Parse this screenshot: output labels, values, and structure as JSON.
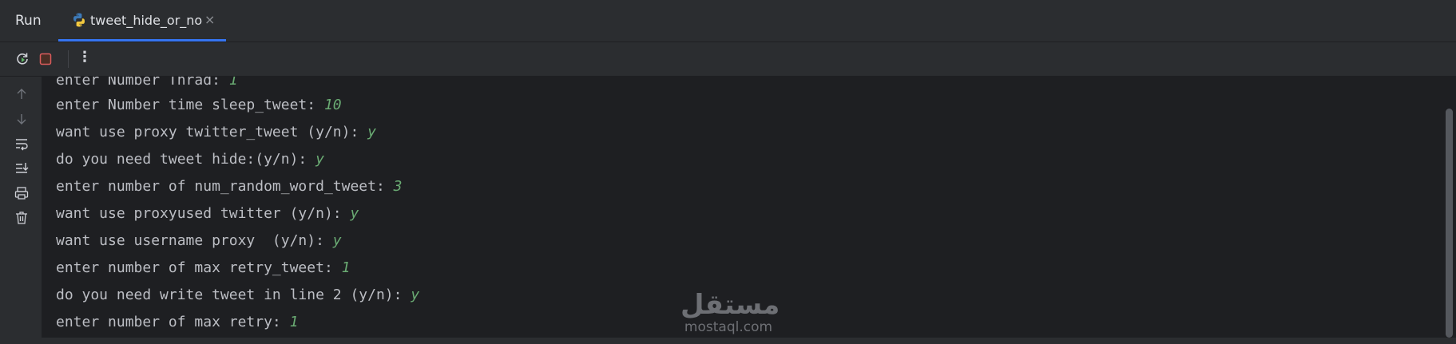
{
  "tabbar": {
    "run_label": "Run",
    "tab_label": "tweet_hide_or_no",
    "close_glyph": "×",
    "accent": "#3574f0"
  },
  "toolbar": {
    "icons": [
      "rerun-icon",
      "stop-icon",
      "more-vertical-icon"
    ],
    "more_glyph": "⋮"
  },
  "gutter": {
    "icons": [
      "arrow-up-icon",
      "arrow-down-icon",
      "soft-wrap-icon",
      "scroll-to-end-icon",
      "print-icon",
      "trash-icon"
    ]
  },
  "console": {
    "input_color": "#6aab73",
    "lines": [
      {
        "prompt": "enter Number Thrad: ",
        "input": "1"
      },
      {
        "prompt": "enter Number time sleep_tweet: ",
        "input": "10"
      },
      {
        "prompt": "want use proxy twitter_tweet (y/n): ",
        "input": "y"
      },
      {
        "prompt": "do you need tweet hide:(y/n): ",
        "input": "y"
      },
      {
        "prompt": "enter number of num_random_word_tweet: ",
        "input": "3"
      },
      {
        "prompt": "want use proxyused twitter (y/n): ",
        "input": "y"
      },
      {
        "prompt": "want use username proxy  (y/n): ",
        "input": "y"
      },
      {
        "prompt": "enter number of max retry_tweet: ",
        "input": "1"
      },
      {
        "prompt": "do you need write tweet in line 2 (y/n): ",
        "input": "y"
      },
      {
        "prompt": "enter number of max retry: ",
        "input": "1"
      }
    ]
  },
  "watermark": {
    "logo": "مستقل",
    "url": "mostaql.com"
  }
}
